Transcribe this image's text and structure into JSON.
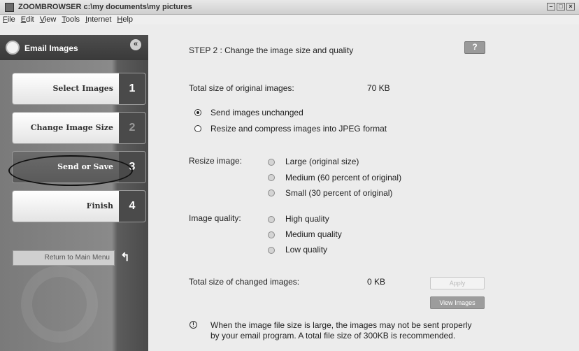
{
  "window": {
    "title": "ZOOMBROWSER c:\\my documents\\my pictures",
    "controls": [
      "minimize-icon",
      "maximize-icon",
      "close-icon"
    ]
  },
  "menu": [
    "File",
    "Edit",
    "View",
    "Tools",
    "Internet",
    "Help"
  ],
  "sidebar": {
    "title": "Email Images",
    "collapse_glyph": "«",
    "steps": [
      {
        "label": "Select Images",
        "number": "1"
      },
      {
        "label": "Change Image Size",
        "number": "2"
      },
      {
        "label": "Send or Save",
        "number": "3"
      },
      {
        "label": "Finish",
        "number": "4"
      }
    ],
    "return_label": "Return to Main Menu",
    "return_glyph": "↰"
  },
  "main": {
    "step_title": "STEP 2 : Change the image size and quality",
    "help_label": "?",
    "total_original_label": "Total size of original images:",
    "total_original_value": "70 KB",
    "option_unchanged": "Send images unchanged",
    "option_resize": "Resize and compress images into JPEG format",
    "resize_label": "Resize image:",
    "resize_options": [
      "Large (original size)",
      "Medium (60 percent of original)",
      "Small (30 percent of original)"
    ],
    "quality_label": "Image quality:",
    "quality_options": [
      "High quality",
      "Medium quality",
      "Low quality"
    ],
    "total_changed_label": "Total size of changed images:",
    "total_changed_value": "0 KB",
    "apply_label": "Apply",
    "view_label": "View Images",
    "warning_glyph": "!",
    "note_line1": "When the image file size is large, the images may not be sent properly",
    "note_line2": "by your email program. A total file size of 300KB is recommended."
  }
}
